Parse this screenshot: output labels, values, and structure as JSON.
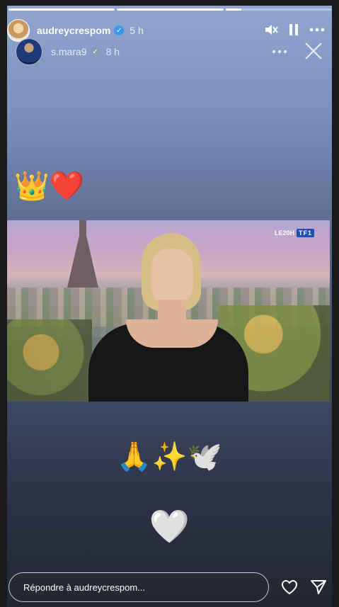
{
  "progress": [
    1.0,
    1.0,
    0.15
  ],
  "author": {
    "username": "audreycrespom",
    "time": "5 h"
  },
  "reshare": {
    "username": "s.mara9",
    "time": "8 h"
  },
  "emojis": {
    "top": "👑❤️",
    "middle": "🙏✨🕊️",
    "bottom": "🤍"
  },
  "video": {
    "channel_text": "LE20H",
    "channel_logo": "TF1"
  },
  "reply": {
    "placeholder": "Répondre à audreycrespom..."
  },
  "icons": [
    "mute-icon",
    "pause-icon",
    "more-icon",
    "close-icon",
    "heart-icon",
    "send-icon",
    "verified-icon"
  ]
}
